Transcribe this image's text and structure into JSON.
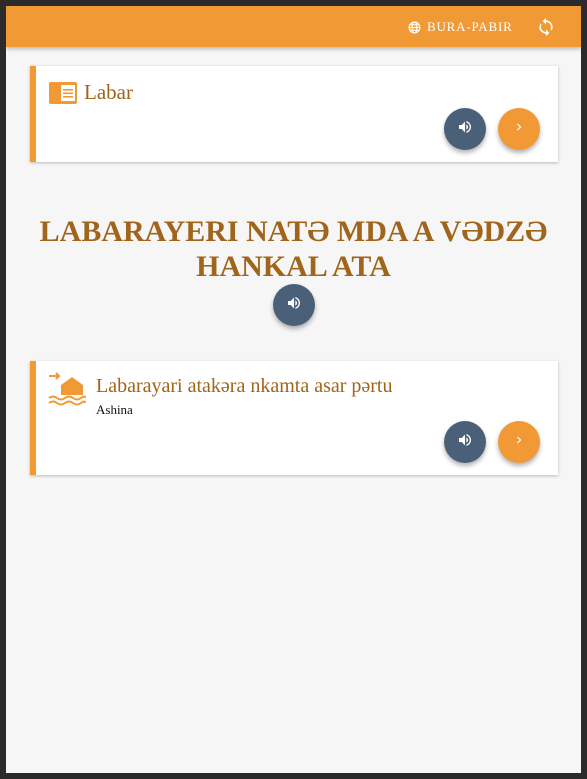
{
  "topbar": {
    "language_label": "BURA-PABIR",
    "language_icon": "globe-icon",
    "sync_icon": "sync-icon",
    "background_color": "#f19a35"
  },
  "cards": [
    {
      "title": "Labar",
      "icon": "news-icon",
      "audio_icon": "volume-icon",
      "next_icon": "chevron-right-icon"
    },
    {
      "title": "Labarayari atakəra nkamta asar pərtu",
      "subtitle": "Ashina",
      "icon": "flood-house-icon",
      "audio_icon": "volume-icon",
      "next_icon": "chevron-right-icon"
    }
  ],
  "heading": {
    "line1": "LABARAYERI NATƏ MDA A VƏDZƏ",
    "line2": "HANKAL ATA"
  },
  "colors": {
    "accent": "#f19a35",
    "title_text": "#a0641a",
    "audio_button": "#4a6079",
    "page_background": "#f6f6f6"
  }
}
